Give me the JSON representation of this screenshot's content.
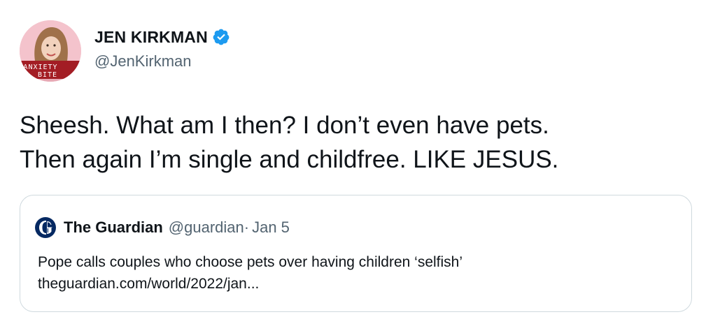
{
  "tweet": {
    "author": {
      "display_name": "JEN KIRKMAN",
      "handle": "@JenKirkman",
      "avatar_caption_line1": "ANXIETY",
      "avatar_caption_line2": "BITE"
    },
    "text_lines": [
      "Sheesh. What am I then? I don’t even have pets.",
      "Then again I’m single and childfree. LIKE JESUS."
    ],
    "quoted_tweet": {
      "display_name": "The Guardian",
      "handle": "@guardian",
      "separator": "·",
      "date": "Jan 5",
      "text": "Pope calls couples who choose pets over having children ‘selfish’",
      "link": "theguardian.com/world/2022/jan..."
    }
  },
  "colors": {
    "text": "#0f1419",
    "secondary": "#536471",
    "verified": "#1d9bf0",
    "border": "#cfd9de",
    "guardian_navy": "#052962"
  },
  "icons": {
    "verified": "verified-badge-icon",
    "quote_logo": "guardian-logo-icon"
  }
}
